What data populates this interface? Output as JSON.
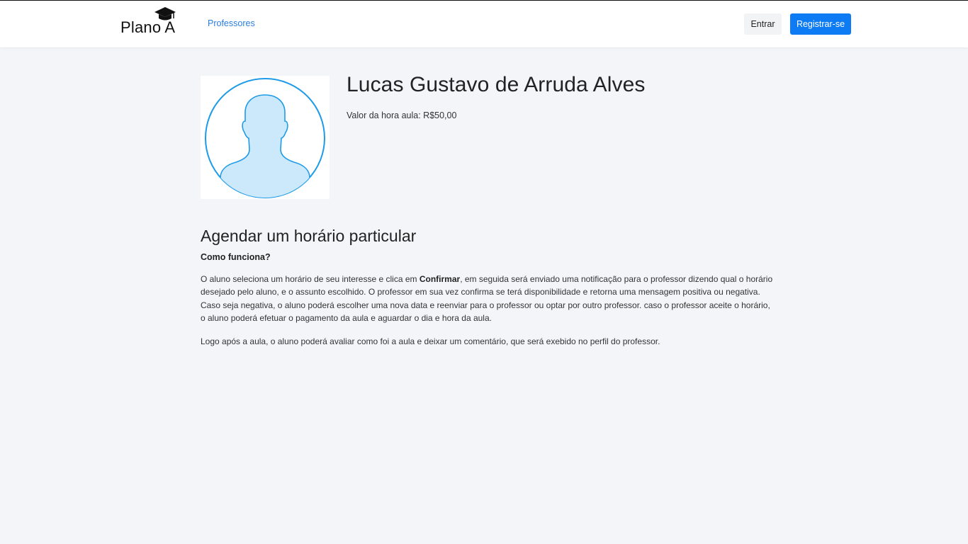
{
  "header": {
    "brand": "Plano A",
    "nav": {
      "professores": "Professores"
    },
    "actions": {
      "login": "Entrar",
      "register": "Registrar-se"
    }
  },
  "profile": {
    "name": "Lucas Gustavo de Arruda Alves",
    "price": "Valor da hora aula: R$50,00",
    "avatar_icon": "user-silhouette-icon"
  },
  "schedule": {
    "title": "Agendar um horário particular",
    "subtitle": "Como funciona?",
    "para1_before": "O aluno seleciona um horário de seu interesse e clica em ",
    "para1_bold": "Confirmar",
    "para1_after": ", em seguida será enviado uma notificação para o professor dizendo qual o horário desejado pelo aluno, e o assunto escolhido. O professor em sua vez confirma se terá disponibilidade e retorna uma mensagem positiva ou negativa. Caso seja negativa, o aluno poderá escolher uma nova data e reenviar para o professor ou optar por outro professor. caso o professor aceite o horário, o aluno poderá efetuar o pagamento da aula e aguardar o dia e hora da aula.",
    "para2": "Logo após a aula, o aluno poderá avaliar como foi a aula e deixar um comentário, que será exebido no perfil do professor."
  },
  "colors": {
    "accent": "#0d7bf4",
    "link": "#2a7de1",
    "background": "#f3f5f8",
    "avatar_stroke": "#1e9be8",
    "avatar_fill": "#cce9fb"
  }
}
